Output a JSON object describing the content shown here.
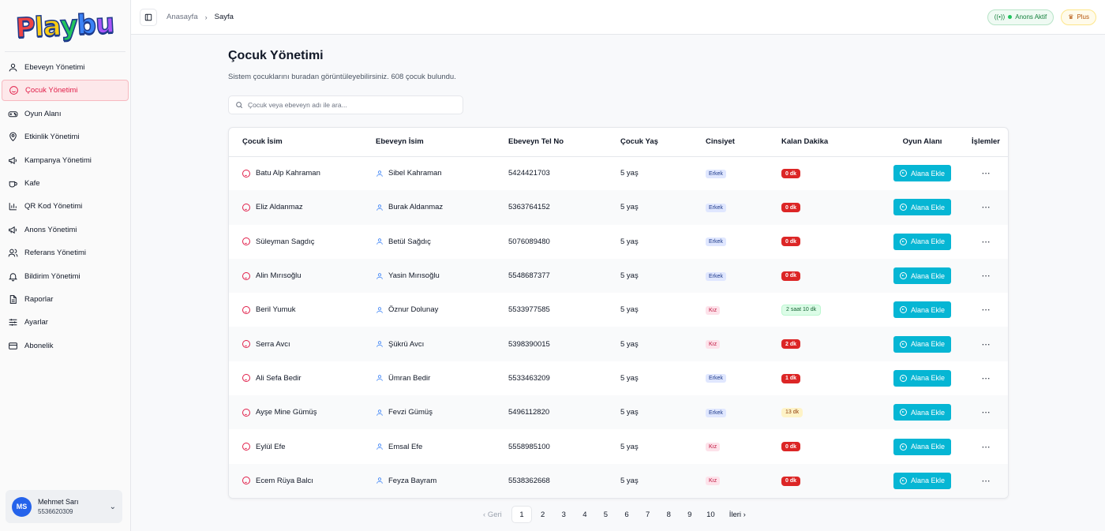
{
  "sidebar": {
    "logo_text": "Playbu",
    "items": [
      {
        "label": "Ebeveyn Yönetimi",
        "icon": "user-icon"
      },
      {
        "label": "Çocuk Yönetimi",
        "icon": "smile-icon"
      },
      {
        "label": "Oyun Alanı",
        "icon": "gamepad-icon"
      },
      {
        "label": "Etkinlik Yönetimi",
        "icon": "map-pin-icon"
      },
      {
        "label": "Kampanya Yönetimi",
        "icon": "megaphone-icon"
      },
      {
        "label": "Kafe",
        "icon": "coffee-icon"
      },
      {
        "label": "QR Kod Yönetimi",
        "icon": "bar-chart-icon"
      },
      {
        "label": "Anons Yönetimi",
        "icon": "megaphone-icon"
      },
      {
        "label": "Referans Yönetimi",
        "icon": "users-icon"
      },
      {
        "label": "Bildirim Yönetimi",
        "icon": "bell-icon"
      },
      {
        "label": "Raporlar",
        "icon": "file-icon"
      },
      {
        "label": "Ayarlar",
        "icon": "sliders-icon"
      },
      {
        "label": "Abonelik",
        "icon": "credit-card-icon"
      }
    ],
    "active_index": 1,
    "user": {
      "initials": "MS",
      "name": "Mehmet Sarı",
      "phone": "5536620309"
    }
  },
  "topbar": {
    "breadcrumb_home": "Anasayfa",
    "breadcrumb_current": "Sayfa",
    "announce_label": "Anons Aktif",
    "plan_label": "Plus"
  },
  "page": {
    "title": "Çocuk Yönetimi",
    "subtitle": "Sistem çocuklarını buradan görüntüleyebilirsiniz. 608 çocuk bulundu.",
    "search_placeholder": "Çocuk veya ebeveyn adı ile ara..."
  },
  "table": {
    "headers": [
      "Çocuk İsim",
      "Ebeveyn İsim",
      "Ebeveyn Tel No",
      "Çocuk Yaş",
      "Cinsiyet",
      "Kalan Dakika",
      "Oyun Alanı",
      "İşlemler"
    ],
    "add_label": "Alana Ekle",
    "rows": [
      {
        "child": "Batu Alp Kahraman",
        "parent": "Sibel Kahraman",
        "phone": "5424421703",
        "age": "5 yaş",
        "gender": "Erkek",
        "remaining": "0 dk",
        "status": "red"
      },
      {
        "child": "Eliz Aldanmaz",
        "parent": "Burak Aldanmaz",
        "phone": "5363764152",
        "age": "5 yaş",
        "gender": "Erkek",
        "remaining": "0 dk",
        "status": "red"
      },
      {
        "child": "Süleyman Sagdıç",
        "parent": "Betül Sağdıç",
        "phone": "5076089480",
        "age": "5 yaş",
        "gender": "Erkek",
        "remaining": "0 dk",
        "status": "red"
      },
      {
        "child": "Alin Mırısoğlu",
        "parent": "Yasin Mırısoğlu",
        "phone": "5548687377",
        "age": "5 yaş",
        "gender": "Erkek",
        "remaining": "0 dk",
        "status": "red"
      },
      {
        "child": "Beril Yumuk",
        "parent": "Öznur Dolunay",
        "phone": "5533977585",
        "age": "5 yaş",
        "gender": "Kız",
        "remaining": "2 saat 10 dk",
        "status": "green"
      },
      {
        "child": "Serra Avcı",
        "parent": "Şükrü Avcı",
        "phone": "5398390015",
        "age": "5 yaş",
        "gender": "Kız",
        "remaining": "2 dk",
        "status": "red"
      },
      {
        "child": "Ali Sefa Bedir",
        "parent": "Ümran Bedir",
        "phone": "5533463209",
        "age": "5 yaş",
        "gender": "Erkek",
        "remaining": "1 dk",
        "status": "red"
      },
      {
        "child": "Ayşe Mine Gümüş",
        "parent": "Fevzi Gümüş",
        "phone": "5496112820",
        "age": "5 yaş",
        "gender": "Erkek",
        "remaining": "13 dk",
        "status": "yellow"
      },
      {
        "child": "Eylül Efe",
        "parent": "Emsal Efe",
        "phone": "5558985100",
        "age": "5 yaş",
        "gender": "Kız",
        "remaining": "0 dk",
        "status": "red"
      },
      {
        "child": "Ecem Rüya Balcı",
        "parent": "Feyza Bayram",
        "phone": "5538362668",
        "age": "5 yaş",
        "gender": "Kız",
        "remaining": "0 dk",
        "status": "red"
      }
    ]
  },
  "pagination": {
    "prev_label": "Geri",
    "next_label": "İleri",
    "pages": [
      "1",
      "2",
      "3",
      "4",
      "5",
      "6",
      "7",
      "8",
      "9",
      "10"
    ],
    "current": "1"
  },
  "colors": {
    "accent_rose": "#e11d48",
    "cyan_button": "#06b6d4",
    "red_badge": "#dc2626"
  }
}
